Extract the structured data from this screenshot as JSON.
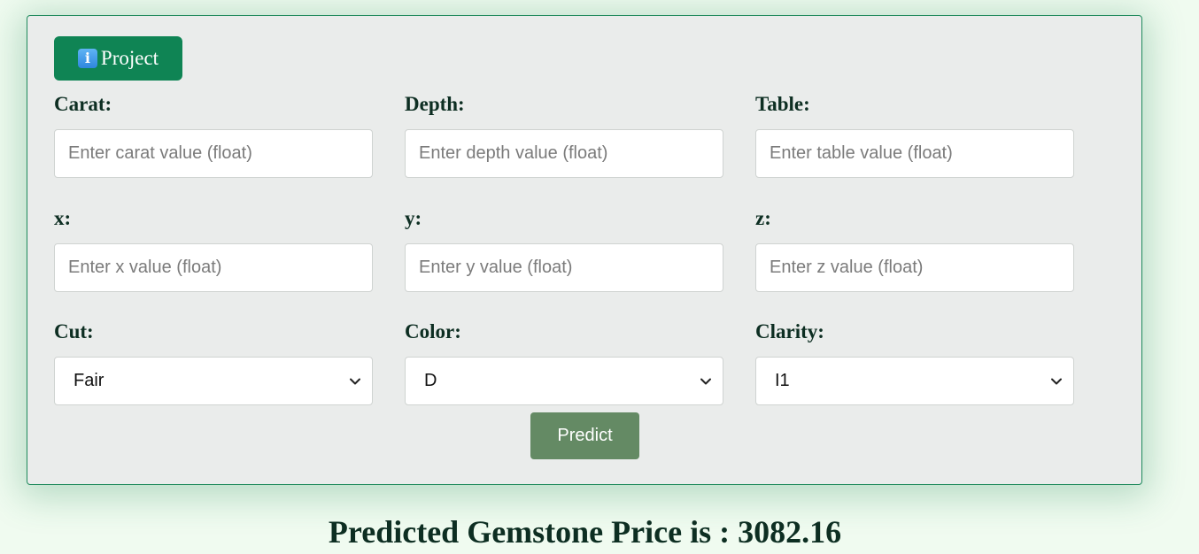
{
  "project_button": {
    "icon": "info-icon",
    "icon_glyph": "i",
    "label": "Project"
  },
  "fields": {
    "carat": {
      "label": "Carat:",
      "placeholder": "Enter carat value (float)",
      "value": ""
    },
    "depth": {
      "label": "Depth:",
      "placeholder": "Enter depth value (float)",
      "value": ""
    },
    "table": {
      "label": "Table:",
      "placeholder": "Enter table value (float)",
      "value": ""
    },
    "x": {
      "label": "x:",
      "placeholder": "Enter x value (float)",
      "value": ""
    },
    "y": {
      "label": "y:",
      "placeholder": "Enter y value (float)",
      "value": ""
    },
    "z": {
      "label": "z:",
      "placeholder": "Enter z value (float)",
      "value": ""
    }
  },
  "selects": {
    "cut": {
      "label": "Cut:",
      "selected": "Fair"
    },
    "color": {
      "label": "Color:",
      "selected": "D"
    },
    "clarity": {
      "label": "Clarity:",
      "selected": "I1"
    }
  },
  "predict_button": {
    "label": "Predict"
  },
  "result": {
    "text": "Predicted Gemstone Price is : 3082.16"
  },
  "colors": {
    "page_bg": "#f0fbf0",
    "card_bg": "#eaeceb",
    "project_button": "#0f8454",
    "predict_button": "#648a64",
    "label_text": "#0d2e22"
  }
}
